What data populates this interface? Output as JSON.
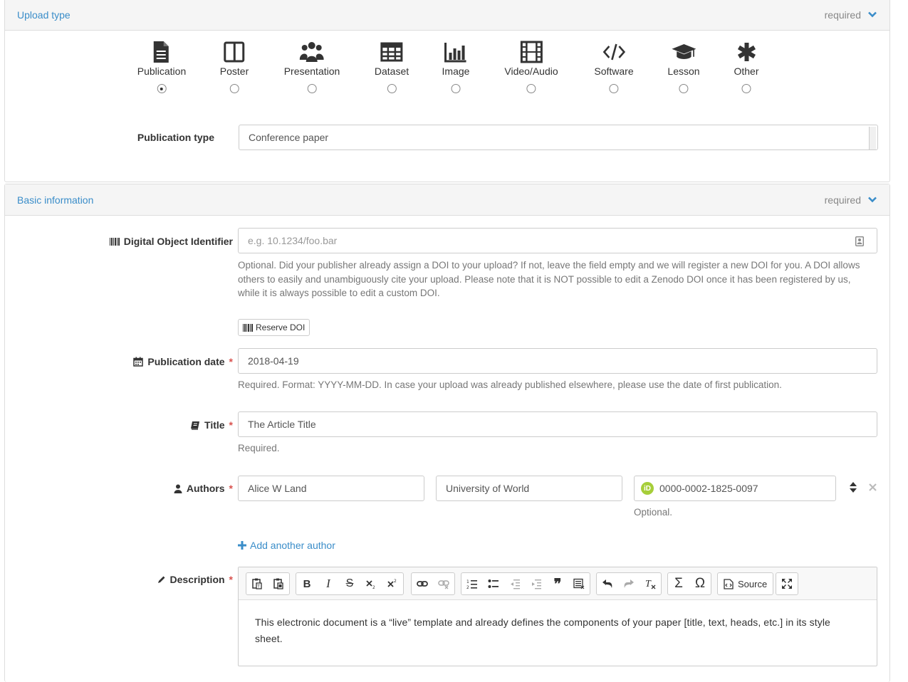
{
  "upload_panel": {
    "title": "Upload type",
    "required": "required",
    "types": [
      {
        "label": "Publication",
        "icon": "file-text-icon",
        "checked": true
      },
      {
        "label": "Poster",
        "icon": "columns-icon",
        "checked": false
      },
      {
        "label": "Presentation",
        "icon": "users-icon",
        "checked": false
      },
      {
        "label": "Dataset",
        "icon": "table-icon",
        "checked": false
      },
      {
        "label": "Image",
        "icon": "bar-chart-icon",
        "checked": false
      },
      {
        "label": "Video/Audio",
        "icon": "film-icon",
        "checked": false
      },
      {
        "label": "Software",
        "icon": "code-icon",
        "checked": false
      },
      {
        "label": "Lesson",
        "icon": "graduation-cap-icon",
        "checked": false
      },
      {
        "label": "Other",
        "icon": "asterisk-icon",
        "checked": false
      }
    ],
    "publication_type_label": "Publication type",
    "publication_type_value": "Conference paper"
  },
  "basic_panel": {
    "title": "Basic information",
    "required": "required",
    "doi_label": "Digital Object Identifier",
    "doi_placeholder": "e.g. 10.1234/foo.bar",
    "doi_help": "Optional. Did your publisher already assign a DOI to your upload? If not, leave the field empty and we will register a new DOI for you. A DOI allows others to easily and unambiguously cite your upload. Please note that it is NOT possible to edit a Zenodo DOI once it has been registered by us, while it is always possible to edit a custom DOI.",
    "reserve_doi": "Reserve DOI",
    "date_label": "Publication date",
    "date_value": "2018-04-19",
    "date_help": "Required. Format: YYYY-MM-DD. In case your upload was already published elsewhere, please use the date of first publication.",
    "title_label": "Title",
    "title_value": "The Article Title",
    "title_help": "Required.",
    "authors_label": "Authors",
    "author_name": "Alice W Land",
    "author_affiliation": "University of World",
    "author_orcid": "0000-0002-1825-0097",
    "orcid_badge": "iD",
    "orcid_help": "Optional.",
    "add_author": "Add another author",
    "description_label": "Description",
    "source_label": "Source",
    "description_text": "This electronic document is a “live” template and already defines  the components of your paper [title, text, heads, etc.] in its style sheet."
  },
  "required_star": "*",
  "colors": {
    "accent": "#3a8dc9",
    "required": "#d9534f",
    "orcid": "#a6ce39"
  }
}
